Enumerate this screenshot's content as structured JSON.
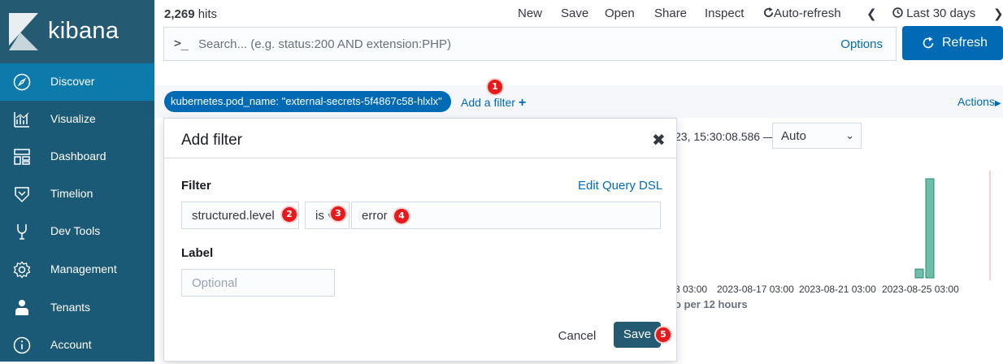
{
  "app": {
    "name": "kibana"
  },
  "sidebar": {
    "items": [
      {
        "label": "Discover",
        "icon": "compass-icon",
        "active": true
      },
      {
        "label": "Visualize",
        "icon": "chart-icon"
      },
      {
        "label": "Dashboard",
        "icon": "dashboard-icon"
      },
      {
        "label": "Timelion",
        "icon": "timelion-icon"
      },
      {
        "label": "Dev Tools",
        "icon": "wrench-icon"
      },
      {
        "label": "Management",
        "icon": "gear-icon"
      },
      {
        "label": "Tenants",
        "icon": "user-icon"
      },
      {
        "label": "Account",
        "icon": "info-icon"
      }
    ]
  },
  "topbar": {
    "hits_count": "2,269",
    "hits_label": " hits",
    "menu": {
      "new": "New",
      "save": "Save",
      "open": "Open",
      "share": "Share",
      "inspect": "Inspect",
      "auto_refresh": "Auto-refresh",
      "time_range": "Last 30 days"
    },
    "search_prompt": ">_",
    "search_placeholder": "Search... (e.g. status:200 AND extension:PHP)",
    "options": "Options",
    "refresh": "Refresh"
  },
  "filterbar": {
    "pill": "kubernetes.pod_name: \"external-secrets-5f4867c58-hlxlx\"",
    "add_filter": "Add a filter",
    "actions": "Actions"
  },
  "chart": {
    "timestamp_text": "23, 15:30:08.586 —",
    "interval_select": "Auto",
    "interval_text": "o per 12 hours",
    "x_ticks": [
      "3 03:00",
      "2023-08-17 03:00",
      "2023-08-21 03:00",
      "2023-08-25 03:00"
    ]
  },
  "chart_data": {
    "type": "bar",
    "x": [
      "2023-08-25 21:00",
      "2023-08-26 09:00"
    ],
    "values": [
      80,
      900
    ],
    "color": "#54b399"
  },
  "modal": {
    "title": "Add filter",
    "filter_label": "Filter",
    "edit_query_dsl": "Edit Query DSL",
    "field_value": "structured.level",
    "operator_value": "is",
    "value_value": "error",
    "label_label": "Label",
    "label_placeholder": "Optional",
    "cancel": "Cancel",
    "save": "Save"
  },
  "badges": [
    "1",
    "2",
    "3",
    "4",
    "5"
  ],
  "colors": {
    "sidebar": "#1a5a76",
    "active": "#0c7bab",
    "primary": "#006bb4",
    "badge": "#e8191a"
  }
}
